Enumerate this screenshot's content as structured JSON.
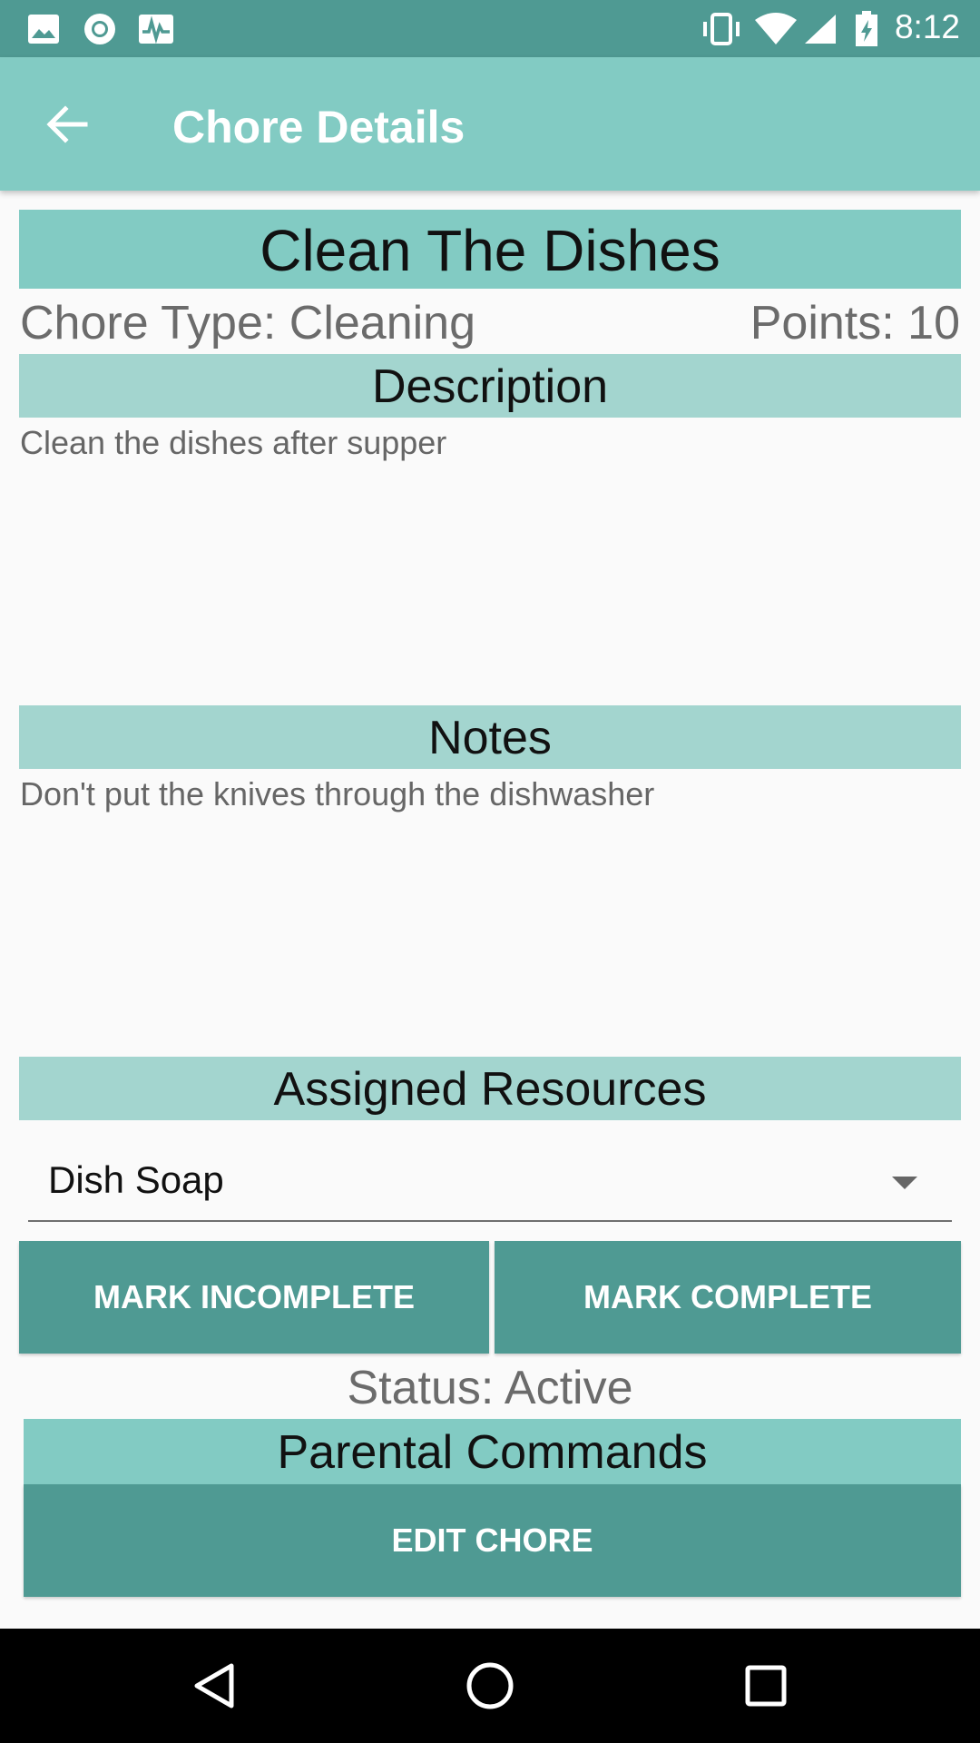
{
  "status_bar": {
    "time": "8:12",
    "left_icons": [
      "image-icon",
      "circle-record-icon",
      "activity-icon"
    ],
    "right_icons": [
      "vibrate-icon",
      "wifi-icon",
      "signal-icon",
      "battery-charging-icon"
    ]
  },
  "app_bar": {
    "title": "Chore Details",
    "back_icon": "arrow-left-icon"
  },
  "chore": {
    "title": "Clean The Dishes",
    "type_text": "Chore Type: Cleaning",
    "points_text": "Points: 10"
  },
  "description": {
    "heading": "Description",
    "text": "Clean the dishes after supper"
  },
  "notes": {
    "heading": "Notes",
    "text": "Don't put the knives through the dishwasher"
  },
  "resources": {
    "heading": "Assigned Resources",
    "selected": "Dish Soap"
  },
  "actions": {
    "mark_incomplete": "MARK INCOMPLETE",
    "mark_complete": "MARK COMPLETE"
  },
  "status_text": "Status: Active",
  "parental": {
    "heading": "Parental Commands",
    "edit_label": "EDIT CHORE"
  },
  "nav_bar": {
    "icons": [
      "back-triangle-icon",
      "home-circle-icon",
      "recents-square-icon"
    ]
  },
  "colors": {
    "status_bar": "#4f9a93",
    "app_bar": "#82cbc3",
    "section_header": "#a3d5cf",
    "button": "#4f9a93"
  }
}
